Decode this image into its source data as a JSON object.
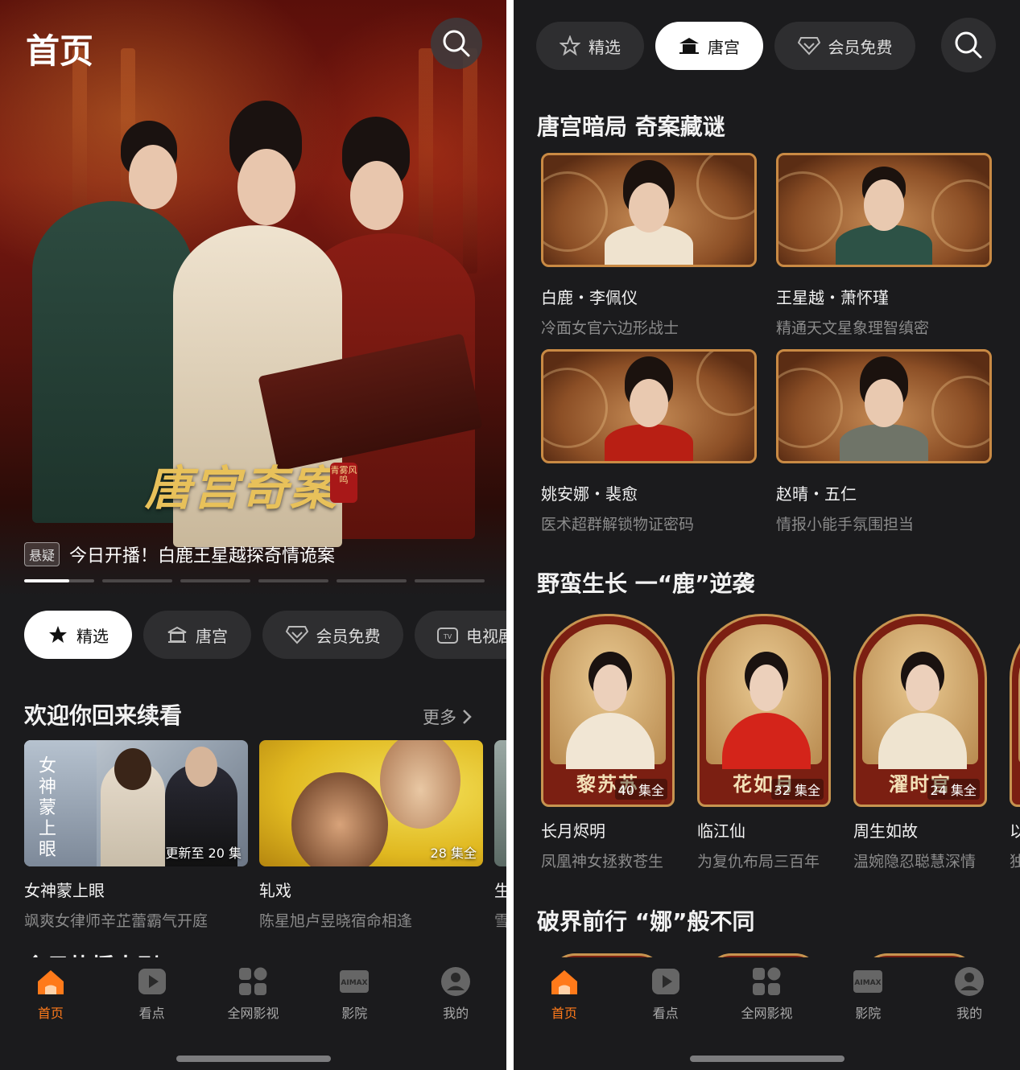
{
  "left": {
    "page_title": "首页",
    "hero": {
      "logo_text": "唐宫奇案",
      "seal_text": "青雾风鸣",
      "tag": "悬疑",
      "caption": "今日开播！白鹿王星越探奇情诡案",
      "slide_count": 6,
      "active_slide": 1
    },
    "chips": [
      {
        "label": "精选",
        "icon": "star-icon",
        "active": true
      },
      {
        "label": "唐宫",
        "icon": "palace-icon",
        "active": false
      },
      {
        "label": "会员免费",
        "icon": "diamond-icon",
        "active": false
      },
      {
        "label": "电视剧",
        "icon": "tv-icon",
        "active": false
      }
    ],
    "continue_section": {
      "title": "欢迎你回来续看",
      "more": "更多",
      "cards": [
        {
          "title": "女神蒙上眼",
          "subtitle": "飒爽女律师辛芷蕾霸气开庭",
          "badge": "更新至 20 集",
          "poster_text": "女神蒙上眼"
        },
        {
          "title": "轧戏",
          "subtitle": "陈星旭卢昱晓宿命相逢",
          "badge": "28 集全"
        },
        {
          "title": "生",
          "subtitle": "雪"
        }
      ]
    },
    "next_section_title": "今日热播大剧"
  },
  "right": {
    "chips": [
      {
        "label": "精选",
        "icon": "star-icon",
        "active": false
      },
      {
        "label": "唐宫",
        "icon": "palace-icon",
        "active": true
      },
      {
        "label": "会员免费",
        "icon": "diamond-icon",
        "active": false
      }
    ],
    "section1": {
      "title": "唐宫暗局 奇案藏谜",
      "cards": [
        {
          "title": "白鹿・李佩仪",
          "subtitle": "冷面女官六边形战士"
        },
        {
          "title": "王星越・萧怀瑾",
          "subtitle": "精通天文星象理智缜密"
        },
        {
          "title": "姚安娜・裴愈",
          "subtitle": "医术超群解锁物证密码"
        },
        {
          "title": "赵晴・五仁",
          "subtitle": "情报小能手氛围担当"
        }
      ]
    },
    "section2": {
      "title": "野蛮生长 一“鹿”逆袭",
      "cards": [
        {
          "name": "黎苏苏",
          "badge": "40 集全",
          "title": "长月烬明",
          "subtitle": "凤凰神女拯救苍生"
        },
        {
          "name": "花如月",
          "badge": "32 集全",
          "title": "临江仙",
          "subtitle": "为复仇布局三百年"
        },
        {
          "name": "濯时官",
          "badge": "24 集全",
          "title": "周生如故",
          "subtitle": "温婉隐忍聪慧深情"
        },
        {
          "name": "",
          "badge": "",
          "title": "以",
          "subtitle": "独"
        }
      ]
    },
    "section3": {
      "title": "破界前行 “娜”般不同"
    }
  },
  "nav": [
    {
      "label": "首页",
      "icon": "home-icon",
      "active": true
    },
    {
      "label": "看点",
      "icon": "play-icon",
      "active": false
    },
    {
      "label": "全网影视",
      "icon": "grid-icon",
      "active": false
    },
    {
      "label": "影院",
      "icon": "imax-icon",
      "active": false
    },
    {
      "label": "我的",
      "icon": "profile-icon",
      "active": false
    }
  ],
  "colors": {
    "accent": "#ff7a1a",
    "background": "#1b1b1d",
    "chip": "#2e2e30",
    "chip_active": "#ffffff"
  }
}
